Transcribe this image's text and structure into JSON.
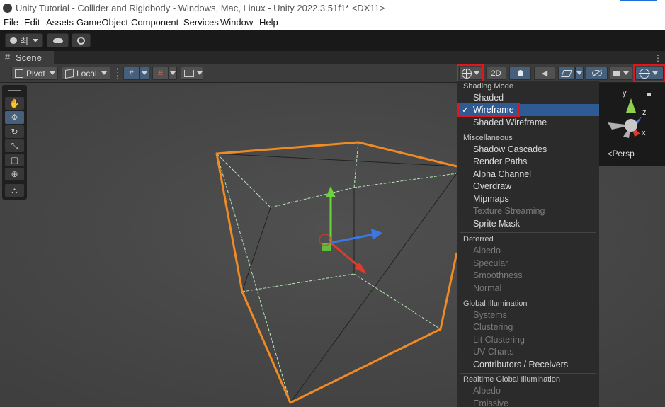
{
  "window": {
    "title": "Unity Tutorial - Collider and Rigidbody - Windows, Mac, Linux - Unity 2022.3.51f1* <DX11>"
  },
  "menubar": {
    "items": [
      "File",
      "Edit",
      "Assets",
      "GameObject",
      "Component",
      "Services",
      "Window",
      "Help"
    ]
  },
  "account": {
    "name": "최"
  },
  "scene_tab": {
    "label": "Scene"
  },
  "scene_toolbar": {
    "pivot_label": "Pivot",
    "local_label": "Local",
    "mode_2d_label": "2D"
  },
  "gizmo": {
    "persp_label": "Persp",
    "axis_x": "x",
    "axis_y": "y",
    "axis_z": "z"
  },
  "shading_menu": {
    "check_mark": "✓",
    "sections": [
      {
        "header": "Shading Mode",
        "items": [
          {
            "label": "Shaded",
            "enabled": true
          },
          {
            "label": "Wireframe",
            "enabled": true,
            "selected": true
          },
          {
            "label": "Shaded Wireframe",
            "enabled": true
          }
        ]
      },
      {
        "header": "Miscellaneous",
        "items": [
          {
            "label": "Shadow Cascades",
            "enabled": true
          },
          {
            "label": "Render Paths",
            "enabled": true
          },
          {
            "label": "Alpha Channel",
            "enabled": true
          },
          {
            "label": "Overdraw",
            "enabled": true
          },
          {
            "label": "Mipmaps",
            "enabled": true
          },
          {
            "label": "Texture Streaming",
            "enabled": false
          },
          {
            "label": "Sprite Mask",
            "enabled": true
          }
        ]
      },
      {
        "header": "Deferred",
        "items": [
          {
            "label": "Albedo",
            "enabled": false
          },
          {
            "label": "Specular",
            "enabled": false
          },
          {
            "label": "Smoothness",
            "enabled": false
          },
          {
            "label": "Normal",
            "enabled": false
          }
        ]
      },
      {
        "header": "Global Illumination",
        "items": [
          {
            "label": "Systems",
            "enabled": false
          },
          {
            "label": "Clustering",
            "enabled": false
          },
          {
            "label": "Lit Clustering",
            "enabled": false
          },
          {
            "label": "UV Charts",
            "enabled": false
          },
          {
            "label": "Contributors / Receivers",
            "enabled": true
          }
        ]
      },
      {
        "header": "Realtime Global Illumination",
        "items": [
          {
            "label": "Albedo",
            "enabled": false
          },
          {
            "label": "Emissive",
            "enabled": false
          }
        ]
      }
    ]
  },
  "colors": {
    "selection_outline": "#f08a24",
    "highlight_box": "#e0161f",
    "selected_item_bg": "#2e5b93",
    "axis_y": "#6cd43a",
    "axis_z": "#3a78e6",
    "axis_x": "#e03a2a"
  }
}
